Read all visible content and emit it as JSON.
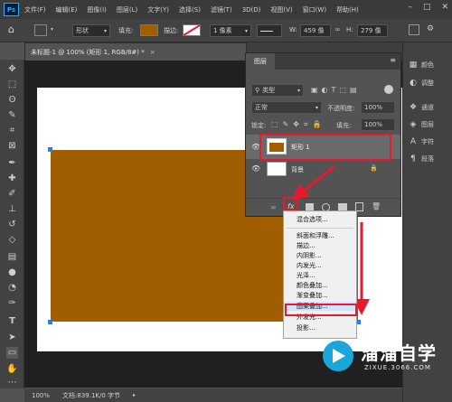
{
  "menubar": {
    "logo": "Ps",
    "items": [
      "文件(F)",
      "编辑(E)",
      "图像(I)",
      "图层(L)",
      "文字(Y)",
      "选择(S)",
      "滤镜(T)",
      "3D(D)",
      "视图(V)",
      "窗口(W)",
      "帮助(H)"
    ]
  },
  "optbar": {
    "mode": "形状",
    "fill_label": "填充:",
    "stroke_label": "描边:",
    "stroke_width": "1 像素",
    "w_label": "W:",
    "w_value": "459 像",
    "h_label": "H:",
    "h_value": "279 像"
  },
  "document": {
    "tab_title": "未标题-1 @ 100% (矩形 1, RGB/8#) *",
    "close": "×"
  },
  "statusbar": {
    "zoom": "100%",
    "doc_info": "文档:839.1K/0 字节"
  },
  "rightpanel": {
    "items": [
      "颜色",
      "调整",
      "通道",
      "图层",
      "字符",
      "段落"
    ]
  },
  "layers_panel": {
    "tab": "图层",
    "filter_kind": "类型",
    "blend_mode": "正常",
    "opacity_label": "不透明度:",
    "opacity_value": "100%",
    "lock_label": "锁定:",
    "fill_label": "填充:",
    "fill_value": "100%",
    "layers": [
      {
        "name": "矩形 1",
        "selected": true
      },
      {
        "name": "背景",
        "selected": false
      }
    ],
    "fx_label": "fx"
  },
  "context_menu": {
    "items": [
      "混合选项...",
      "斜面和浮雕...",
      "描边...",
      "内阴影...",
      "内发光...",
      "光泽...",
      "颜色叠加...",
      "渐变叠加...",
      "图案叠加...",
      "外发光...",
      "投影..."
    ],
    "highlighted": "图案叠加..."
  },
  "watermark": {
    "name": "溜溜自学",
    "url": "ZIXUE.3066.COM"
  },
  "colors": {
    "shape_fill": "#a05e00",
    "highlight": "#e8192c",
    "selection": "#1e7eff"
  }
}
